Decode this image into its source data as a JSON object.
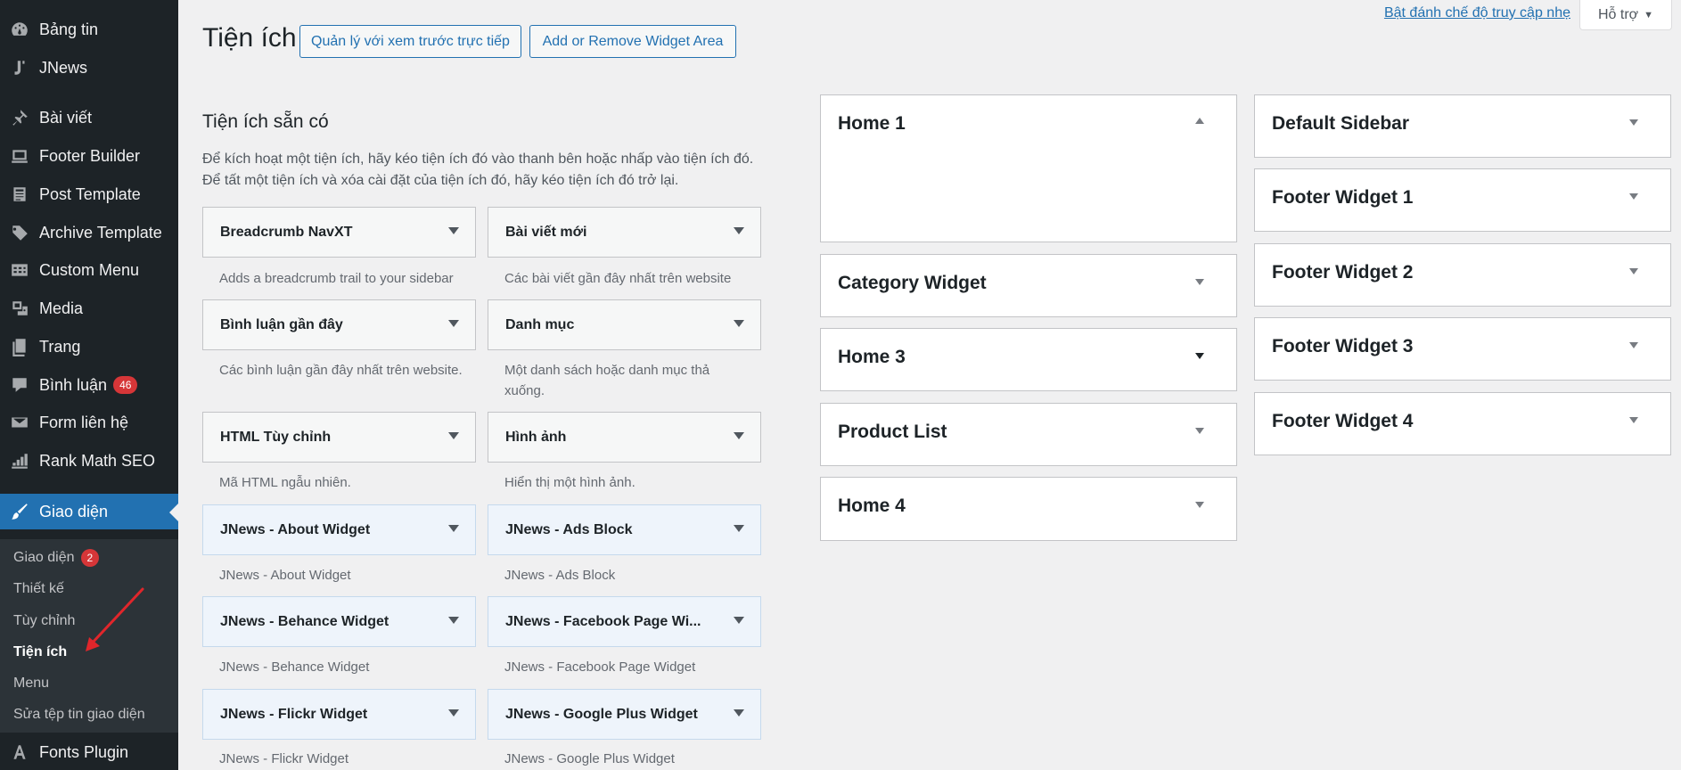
{
  "sidebar": {
    "items": [
      {
        "label": "Bảng tin",
        "icon": "dashboard-icon"
      },
      {
        "label": "JNews",
        "icon": "jnews-icon"
      },
      {
        "label": "Bài viết",
        "icon": "pin-icon"
      },
      {
        "label": "Footer Builder",
        "icon": "monitor-icon"
      },
      {
        "label": "Post Template",
        "icon": "document-icon"
      },
      {
        "label": "Archive Template",
        "icon": "tag-icon"
      },
      {
        "label": "Custom Menu",
        "icon": "table-icon"
      },
      {
        "label": "Media",
        "icon": "media-icon"
      },
      {
        "label": "Trang",
        "icon": "page-icon"
      },
      {
        "label": "Bình luận",
        "icon": "comment-icon",
        "badge": "46"
      },
      {
        "label": "Form liên hệ",
        "icon": "mail-icon"
      },
      {
        "label": "Rank Math SEO",
        "icon": "chart-icon"
      },
      {
        "label": "Giao diện",
        "icon": "brush-icon"
      },
      {
        "label": "Fonts Plugin",
        "icon": "font-icon"
      }
    ],
    "submenu": [
      {
        "label": "Giao diện",
        "badge": "2"
      },
      {
        "label": "Thiết kế"
      },
      {
        "label": "Tùy chỉnh"
      },
      {
        "label": "Tiện ích"
      },
      {
        "label": "Menu"
      },
      {
        "label": "Sửa tệp tin giao diện"
      }
    ]
  },
  "header": {
    "title": "Tiện ích",
    "live_preview_button": "Quản lý với xem trước trực tiếp",
    "widget_area_button": "Add or Remove Widget Area",
    "a11y_link": "Bật đánh chế độ truy cập nhẹ",
    "help_tab": "Hỗ trợ"
  },
  "available": {
    "title": "Tiện ích sẵn có",
    "desc_line1": "Để kích hoạt một tiện ích, hãy kéo tiện ích đó vào thanh bên hoặc nhấp vào tiện ích đó.",
    "desc_line2": "Để tất một tiện ích và xóa cài đặt của tiện ích đó, hãy kéo tiện ích đó trở lại.",
    "widgets": [
      {
        "name": "Breadcrumb NavXT",
        "desc": "Adds a breadcrumb trail to your sidebar"
      },
      {
        "name": "Bài viết mới",
        "desc": "Các bài viết gần đây nhất trên website"
      },
      {
        "name": "Bình luận gần đây",
        "desc": "Các bình luận gần đây nhất trên website."
      },
      {
        "name": "Danh mục",
        "desc": "Một danh sách hoặc danh mục thả xuống."
      },
      {
        "name": "HTML Tùy chỉnh",
        "desc": "Mã HTML ngẫu nhiên."
      },
      {
        "name": "Hình ảnh",
        "desc": "Hiển thị một hình ảnh."
      },
      {
        "name": "JNews - About Widget",
        "desc": "JNews - About Widget"
      },
      {
        "name": "JNews - Ads Block",
        "desc": "JNews - Ads Block"
      },
      {
        "name": "JNews - Behance Widget",
        "desc": "JNews - Behance Widget"
      },
      {
        "name": "JNews - Facebook Page Wi...",
        "desc": "JNews - Facebook Page Widget"
      },
      {
        "name": "JNews - Flickr Widget",
        "desc": "JNews - Flickr Widget"
      },
      {
        "name": "JNews - Google Plus Widget",
        "desc": "JNews - Google Plus Widget"
      }
    ]
  },
  "sidebars_col1": [
    "Home 1",
    "Category Widget",
    "Home 3",
    "Product List",
    "Home 4"
  ],
  "sidebars_col2": [
    "Default Sidebar",
    "Footer Widget 1",
    "Footer Widget 2",
    "Footer Widget 3",
    "Footer Widget 4"
  ],
  "colors": {
    "accent": "#2271b1",
    "sidebar_bg": "#1d2327",
    "badge": "#d63638",
    "annotation_arrow": "#e0262b"
  }
}
